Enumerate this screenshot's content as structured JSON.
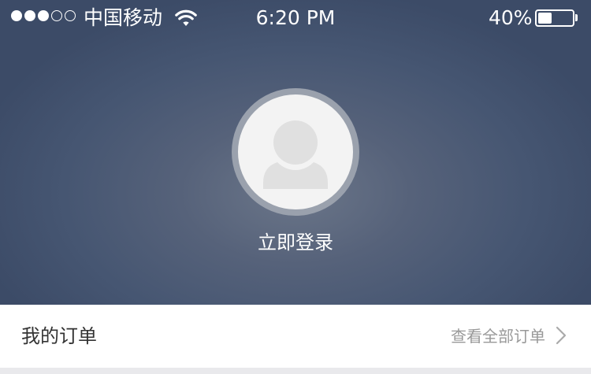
{
  "status_bar": {
    "signal_bars_filled": 3,
    "signal_bars_total": 5,
    "carrier": "中国移动",
    "time": "6:20 PM",
    "battery_percent_label": "40%",
    "battery_level": 0.4,
    "signal_icon": "signal-dots-icon",
    "wifi_icon": "wifi-icon",
    "battery_icon": "battery-icon"
  },
  "profile": {
    "avatar_icon": "user-avatar-placeholder-icon",
    "login_label": "立即登录"
  },
  "orders": {
    "title": "我的订单",
    "view_all_label": "查看全部订单",
    "chevron_icon": "chevron-right-icon"
  },
  "colors": {
    "header_gradient_center": "#6b7689",
    "header_gradient_edge": "#3c4b67",
    "avatar_ring": "#9aa1ad",
    "avatar_bg": "#f3f3f3",
    "avatar_figure": "#e0e0e0",
    "primary_text": "#333333",
    "secondary_text": "#999999",
    "page_background": "#e9e9ec"
  }
}
